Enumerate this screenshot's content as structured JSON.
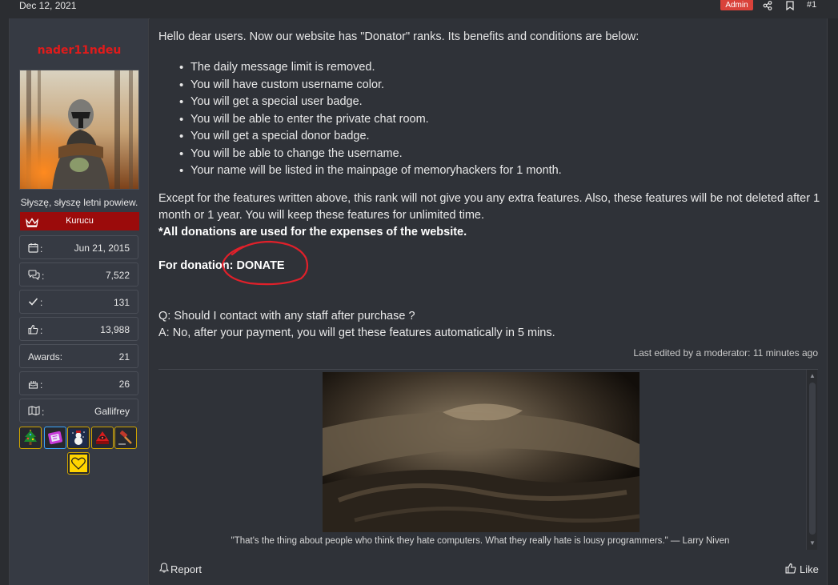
{
  "header": {
    "date": "Dec 12, 2021",
    "admin_badge": "Admin",
    "post_number": "#1"
  },
  "user": {
    "name": "nader11ndeu",
    "custom_title": "Słyszę, słyszę letni powiew.",
    "rank": "Kurucu",
    "stats": [
      {
        "icon": "calendar-icon",
        "label": ":",
        "value": "Jun 21, 2015"
      },
      {
        "icon": "messages-icon",
        "label": ":",
        "value": "7,522"
      },
      {
        "icon": "check-icon",
        "label": ":",
        "value": "131"
      },
      {
        "icon": "thumbs-up-icon",
        "label": ":",
        "value": "13,988"
      },
      {
        "icon": "",
        "label": "Awards:",
        "value": "21"
      },
      {
        "icon": "birthday-cake-icon",
        "label": ":",
        "value": "26"
      },
      {
        "icon": "map-icon",
        "label": ":",
        "value": "Gallifrey"
      }
    ],
    "awards": [
      "christmas-tree-award",
      "ticket-award",
      "snowman-award",
      "red-badge-award",
      "gavel-award",
      "heart-award"
    ]
  },
  "post": {
    "intro": "Hello dear users. Now our website has \"Donator\" ranks. Its benefits and conditions are below:",
    "benefits": [
      "The daily message limit is removed.",
      "You will have custom username color.",
      "You will get a special user badge.",
      "You will be able to enter the private chat room.",
      "You will get a special donor badge.",
      "You will be able to change the username.",
      "Your name will be listed in the mainpage of memoryhackers for 1 month."
    ],
    "paragraph_1": "Except for the features written above, this rank will not give you any extra features. Also, these features will be not deleted after 1 month or 1 year. You will keep these features for unlimited time.",
    "paragraph_bold": "*All donations are used for the expenses of the website.",
    "donation_label": "For donation: ",
    "donation_link": "DONATE",
    "question": "Q: Should I contact with any staff after purchase ?",
    "answer": "A: No, after your payment, you will get these features automatically in 5 mins.",
    "last_edited": "Last edited by a moderator: 11 minutes ago"
  },
  "signature": {
    "quote": "\"That's the thing about people who think they hate computers. What they really hate is lousy programmers.\" — Larry Niven"
  },
  "actions": {
    "report": "Report",
    "like": "Like"
  },
  "colors": {
    "username": "#e11b1b",
    "rank_banner": "#9b0b0b",
    "admin_badge": "#d9423a",
    "annotation_circle": "#e0202a"
  }
}
